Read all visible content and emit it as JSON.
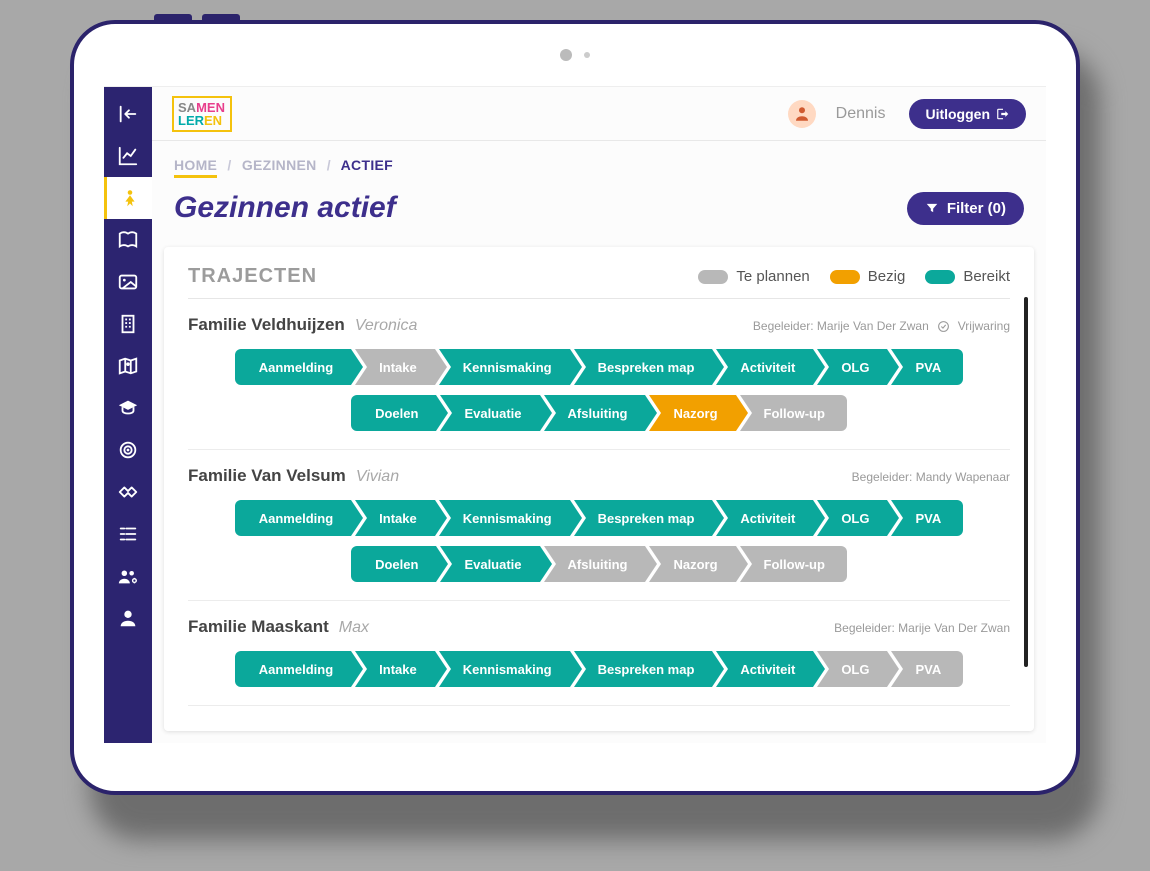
{
  "header": {
    "user": "Dennis",
    "logout": "Uitloggen"
  },
  "breadcrumbs": [
    "HOME",
    "GEZINNEN",
    "ACTIEF"
  ],
  "page": {
    "title": "Gezinnen actief",
    "filter_label": "Filter (0)"
  },
  "colors": {
    "teal": "#0ba89b",
    "orange": "#f2a000",
    "grey": "#b8b8b8",
    "purple": "#3d2f8c"
  },
  "sidebar_icons": [
    "collapse-icon",
    "chart-icon",
    "person-icon",
    "book-icon",
    "image-icon",
    "building-icon",
    "map-icon",
    "graduation-icon",
    "target-icon",
    "handshake-icon",
    "list-icon",
    "group-settings-icon",
    "user-icon"
  ],
  "sidebar_active_index": 2,
  "card": {
    "title": "TRAJECTEN",
    "legend": [
      {
        "label": "Te plannen",
        "status": "grey"
      },
      {
        "label": "Bezig",
        "status": "orange"
      },
      {
        "label": "Bereikt",
        "status": "teal"
      }
    ]
  },
  "begeleider_label": "Begeleider:",
  "families": [
    {
      "name": "Familie Veldhuijzen",
      "sub": "Veronica",
      "begeleider": "Marije Van Der Zwan",
      "vrijwaring": true,
      "vrijwaring_label": "Vrijwaring",
      "rows": [
        [
          {
            "label": "Aanmelding",
            "status": "teal"
          },
          {
            "label": "Intake",
            "status": "grey"
          },
          {
            "label": "Kennismaking",
            "status": "teal"
          },
          {
            "label": "Bespreken map",
            "status": "teal"
          },
          {
            "label": "Activiteit",
            "status": "teal"
          },
          {
            "label": "OLG",
            "status": "teal"
          },
          {
            "label": "PVA",
            "status": "teal"
          }
        ],
        [
          {
            "label": "Doelen",
            "status": "teal"
          },
          {
            "label": "Evaluatie",
            "status": "teal"
          },
          {
            "label": "Afsluiting",
            "status": "teal"
          },
          {
            "label": "Nazorg",
            "status": "orange"
          },
          {
            "label": "Follow-up",
            "status": "grey"
          }
        ]
      ]
    },
    {
      "name": "Familie Van Velsum",
      "sub": "Vivian",
      "begeleider": "Mandy Wapenaar",
      "vrijwaring": false,
      "rows": [
        [
          {
            "label": "Aanmelding",
            "status": "teal"
          },
          {
            "label": "Intake",
            "status": "teal"
          },
          {
            "label": "Kennismaking",
            "status": "teal"
          },
          {
            "label": "Bespreken map",
            "status": "teal"
          },
          {
            "label": "Activiteit",
            "status": "teal"
          },
          {
            "label": "OLG",
            "status": "teal"
          },
          {
            "label": "PVA",
            "status": "teal"
          }
        ],
        [
          {
            "label": "Doelen",
            "status": "teal"
          },
          {
            "label": "Evaluatie",
            "status": "teal"
          },
          {
            "label": "Afsluiting",
            "status": "grey"
          },
          {
            "label": "Nazorg",
            "status": "grey"
          },
          {
            "label": "Follow-up",
            "status": "grey"
          }
        ]
      ]
    },
    {
      "name": "Familie Maaskant",
      "sub": "Max",
      "begeleider": "Marije Van Der Zwan",
      "vrijwaring": false,
      "rows": [
        [
          {
            "label": "Aanmelding",
            "status": "teal"
          },
          {
            "label": "Intake",
            "status": "teal"
          },
          {
            "label": "Kennismaking",
            "status": "teal"
          },
          {
            "label": "Bespreken map",
            "status": "teal"
          },
          {
            "label": "Activiteit",
            "status": "teal"
          },
          {
            "label": "OLG",
            "status": "grey"
          },
          {
            "label": "PVA",
            "status": "grey"
          }
        ]
      ]
    }
  ]
}
